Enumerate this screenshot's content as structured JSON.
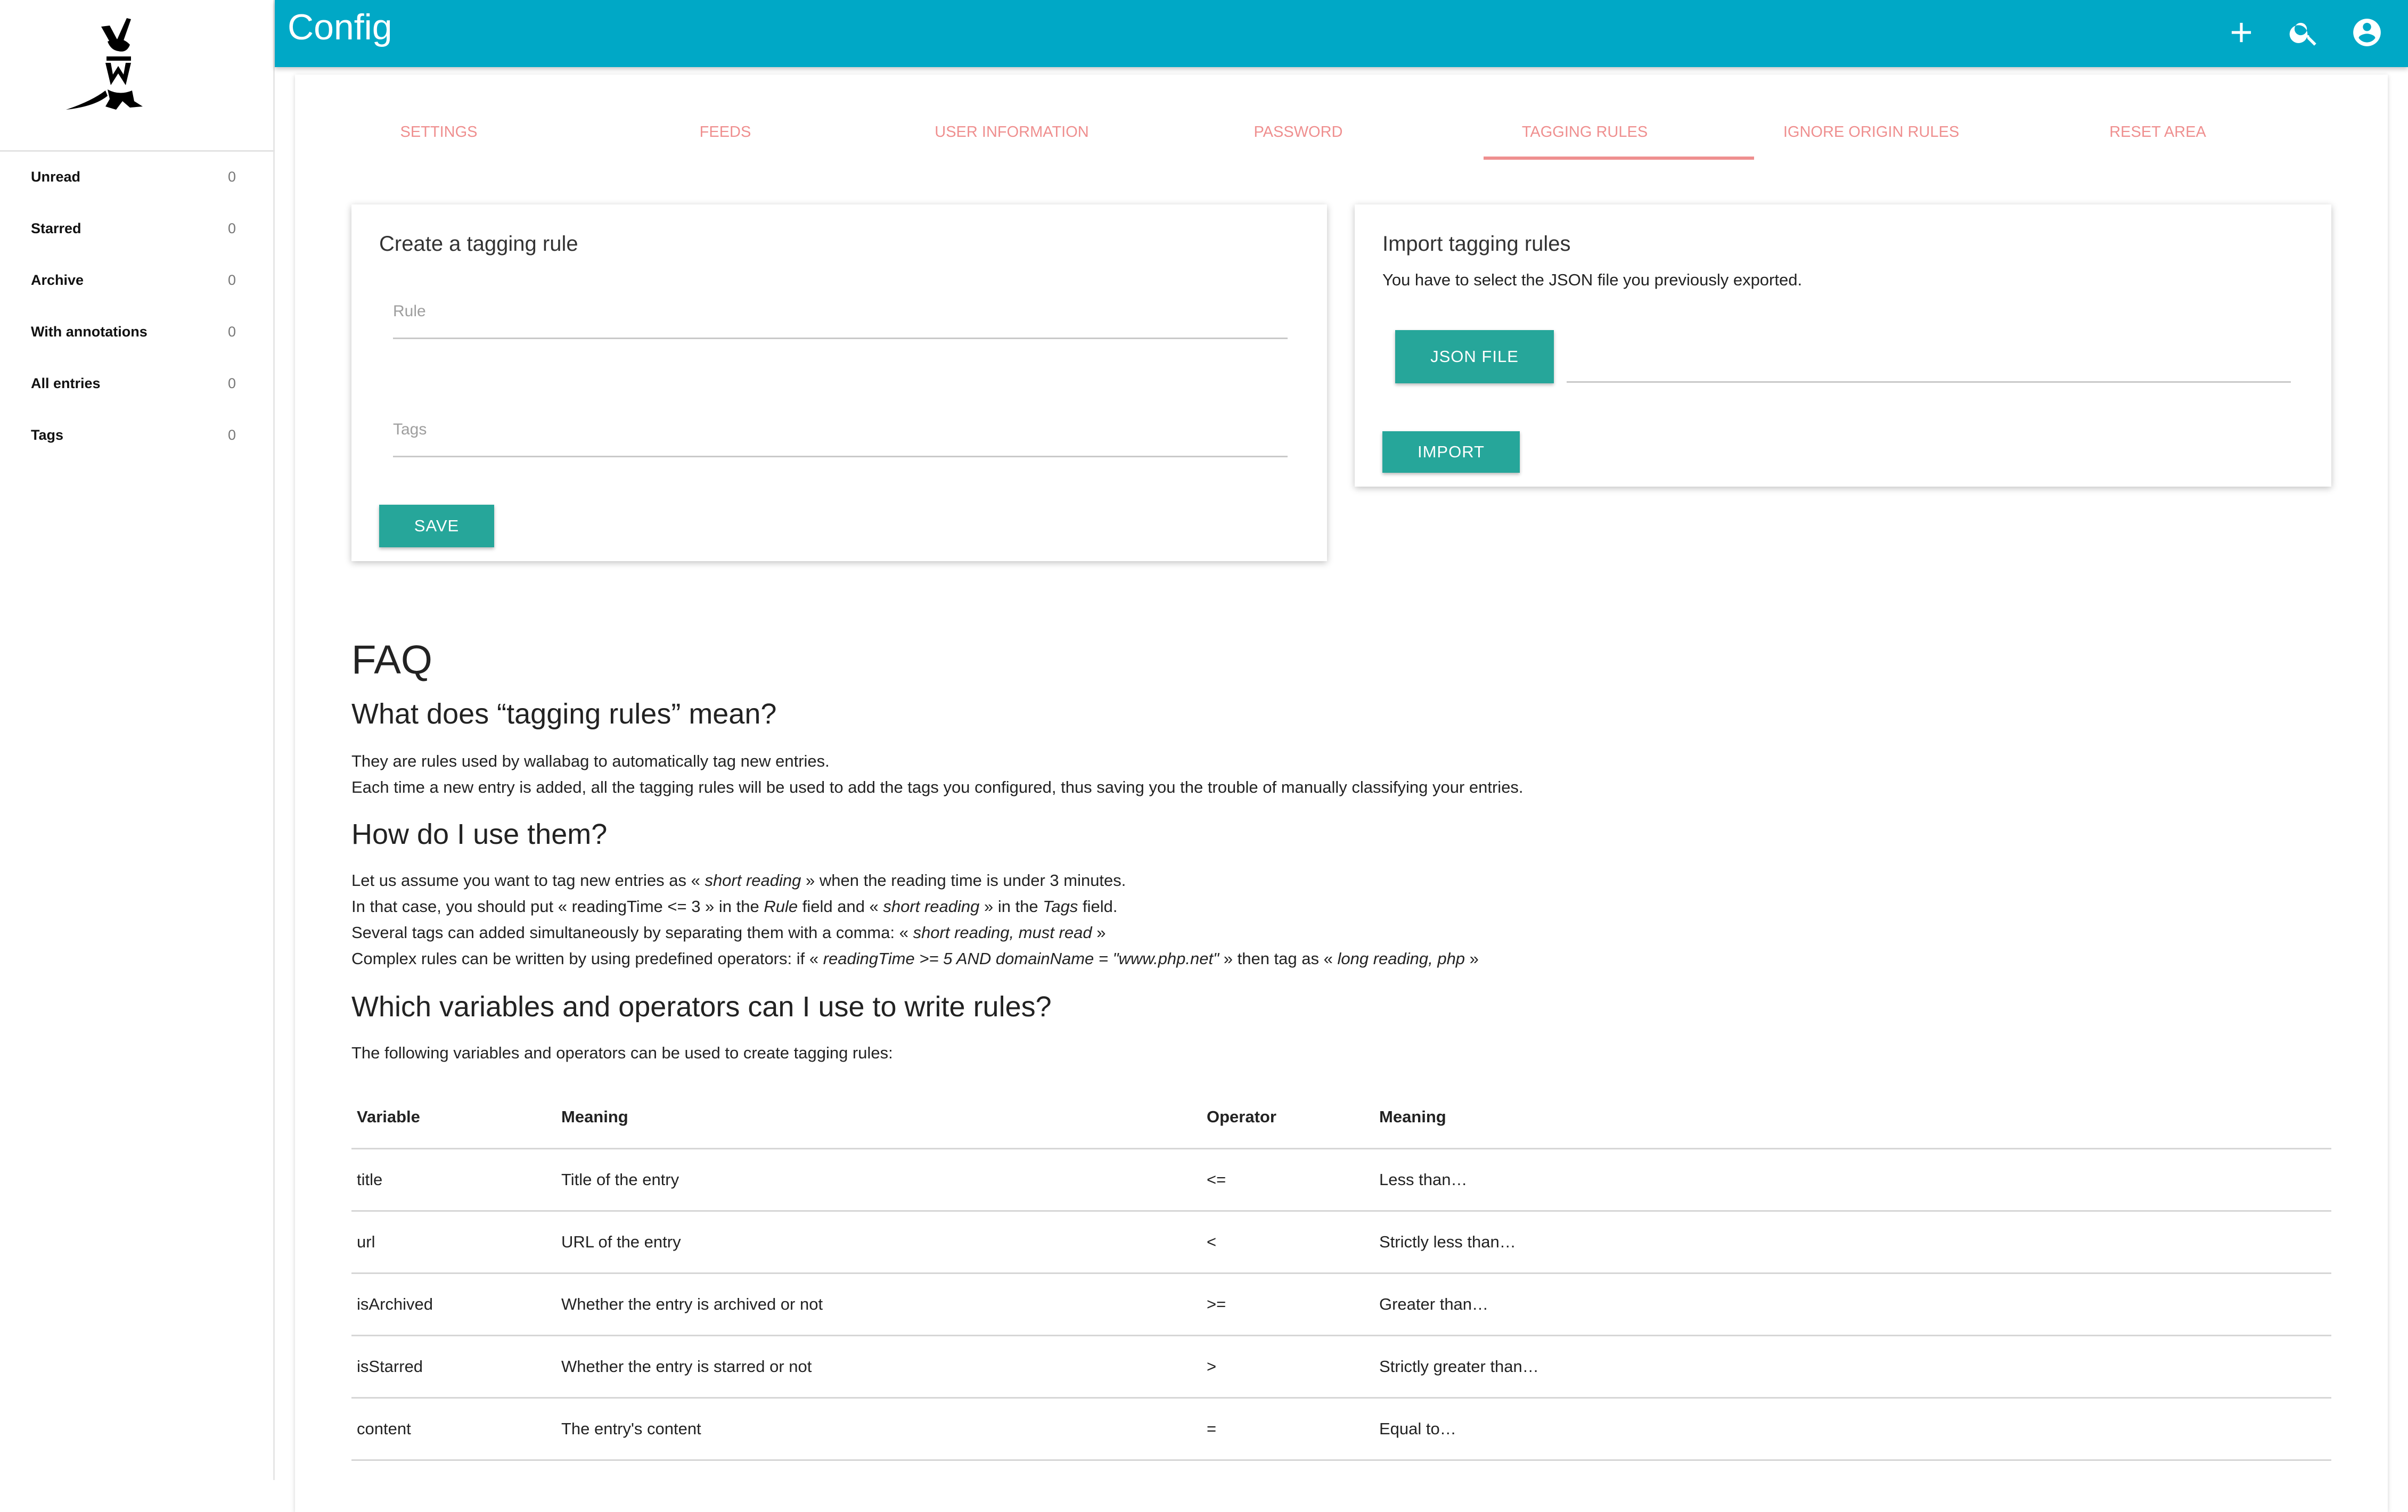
{
  "sidebar": {
    "items": [
      {
        "label": "Unread",
        "count": "0"
      },
      {
        "label": "Starred",
        "count": "0"
      },
      {
        "label": "Archive",
        "count": "0"
      },
      {
        "label": "With annotations",
        "count": "0"
      },
      {
        "label": "All entries",
        "count": "0"
      },
      {
        "label": "Tags",
        "count": "0"
      }
    ]
  },
  "header": {
    "title": "Config",
    "icons": [
      "add-icon",
      "search-icon",
      "account-circle-icon"
    ],
    "color": "#00a8c6"
  },
  "tabs": [
    {
      "label": "SETTINGS"
    },
    {
      "label": "FEEDS"
    },
    {
      "label": "USER INFORMATION"
    },
    {
      "label": "PASSWORD"
    },
    {
      "label": "TAGGING RULES",
      "active": true
    },
    {
      "label": "IGNORE ORIGIN RULES"
    },
    {
      "label": "RESET AREA"
    }
  ],
  "create_rule": {
    "title": "Create a tagging rule",
    "rule_placeholder": "Rule",
    "tags_placeholder": "Tags",
    "save_label": "SAVE"
  },
  "import_rules": {
    "title": "Import tagging rules",
    "description": "You have to select the JSON file you previously exported.",
    "file_button_label": "JSON FILE",
    "import_label": "IMPORT"
  },
  "faq": {
    "title": "FAQ",
    "q1": {
      "title": "What does “tagging rules” mean?",
      "lines": [
        "They are rules used by wallabag to automatically tag new entries.",
        "Each time a new entry is added, all the tagging rules will be used to add the tags you configured, thus saving you the trouble of manually classifying your entries."
      ]
    },
    "q2": {
      "title": "How do I use them?",
      "line1": {
        "a": "Let us assume you want to tag new entries as « ",
        "b": "short reading",
        "c": " » when the reading time is under 3 minutes."
      },
      "line2": {
        "a": "In that case, you should put « readingTime <= 3 » in the ",
        "b": "Rule",
        "c": " field and « ",
        "d": "short reading",
        "e": " » in the ",
        "f": "Tags",
        "g": " field."
      },
      "line3": {
        "a": "Several tags can added simultaneously by separating them with a comma: « ",
        "b": "short reading, must read",
        "c": " »"
      },
      "line4": {
        "a": "Complex rules can be written by using predefined operators: if « ",
        "b": "readingTime >= 5 AND domainName = \"www.php.net\"",
        "c": " » then tag as « ",
        "d": "long reading, php",
        "e": " »"
      }
    },
    "q3": {
      "title": "Which variables and operators can I use to write rules?",
      "intro": "The following variables and operators can be used to create tagging rules:"
    },
    "table": {
      "headers": [
        "Variable",
        "Meaning",
        "Operator",
        "Meaning"
      ],
      "rows": [
        [
          "title",
          "Title of the entry",
          "<=",
          "Less than…"
        ],
        [
          "url",
          "URL of the entry",
          "<",
          "Strictly less than…"
        ],
        [
          "isArchived",
          "Whether the entry is archived or not",
          ">=",
          "Greater than…"
        ],
        [
          "isStarred",
          "Whether the entry is starred or not",
          ">",
          "Strictly greater than…"
        ],
        [
          "content",
          "The entry's content",
          "=",
          "Equal to…"
        ]
      ]
    }
  },
  "colors": {
    "topbar": "#00a8c6",
    "accent": "#26a69a",
    "tab_text": "#ef8f8f"
  }
}
